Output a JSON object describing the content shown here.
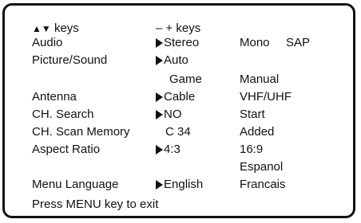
{
  "menu": {
    "header": {
      "nav_hint": "keys",
      "adjust_hint": "– + keys"
    },
    "rows": [
      {
        "label": "Audio",
        "selected": "Stereo",
        "options": [
          "Mono",
          "SAP"
        ]
      },
      {
        "label": "Picture/Sound",
        "selected": "Auto",
        "options": []
      },
      {
        "label": "",
        "selected": "Game",
        "options": [
          "Manual"
        ]
      },
      {
        "label": "Antenna",
        "selected": "Cable",
        "options": [
          "VHF/UHF"
        ]
      },
      {
        "label": "CH. Search",
        "selected": "NO",
        "options": [
          "Start"
        ]
      },
      {
        "label": "CH. Scan Memory",
        "selected": "C 34",
        "options": [
          "Added"
        ]
      },
      {
        "label": "Aspect Ratio",
        "selected": "4:3",
        "options": [
          "16:9",
          "Espanol"
        ]
      },
      {
        "label": "Menu Language",
        "selected": "English",
        "options": [
          "Francais"
        ]
      }
    ],
    "footer": "Press MENU key to exit"
  },
  "icons": {
    "up_down": "up-down-arrows-icon",
    "pointer": "pointer-arrow-icon"
  },
  "colors": {
    "text": "#111111",
    "background": "#ffffff"
  }
}
